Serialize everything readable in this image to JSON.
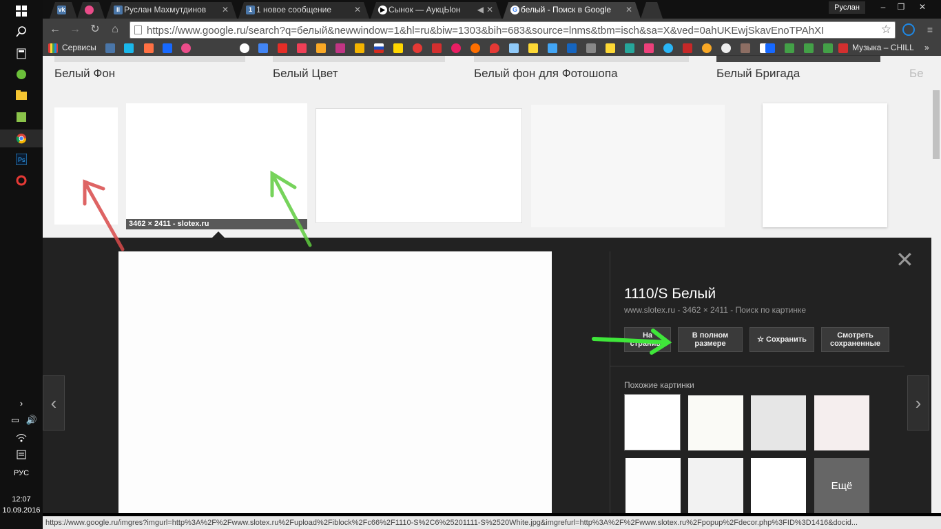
{
  "taskbar": {
    "lang": "РУС",
    "time": "12:07",
    "date": "10.09.2016"
  },
  "tabs": [
    {
      "label": "",
      "favicon": "vk-icon",
      "color": "#4a76a8"
    },
    {
      "label": "",
      "favicon": "dribbble-icon",
      "color": "#ea4c89"
    },
    {
      "label": "Руслан Махмутдинов",
      "favicon": "pause-icon",
      "color": "#4a76a8"
    },
    {
      "label": "1 новое сообщение",
      "favicon": "message-count-icon",
      "color": "#4a76a8"
    },
    {
      "label": "Сынок — АукцЫон",
      "favicon": "play-icon",
      "color": "#ffffff"
    },
    {
      "label": "белый - Поиск в Google",
      "favicon": "google-icon",
      "color": "#ffffff"
    }
  ],
  "window": {
    "user": "Руслан"
  },
  "toolbar": {
    "url": "https://www.google.ru/search?q=белый&newwindow=1&hl=ru&biw=1303&bih=683&source=lnms&tbm=isch&sa=X&ved=0ahUKEwjSkavEnoTPAhXI"
  },
  "bookmarks": {
    "apps_label": "Сервисы",
    "music_label": "Музыка – CHILL"
  },
  "related": [
    {
      "label": "Белый Фон"
    },
    {
      "label": "Белый Цвет"
    },
    {
      "label": "Белый фон для Фотошопа"
    },
    {
      "label": "Белый Бригада"
    },
    {
      "label": "Бе"
    }
  ],
  "grid": {
    "caption": "3462 × 2411 - slotex.ru"
  },
  "panel": {
    "title": "1110/S Белый",
    "subtitle": "www.slotex.ru - 3462 × 2411 - Поиск по картинке",
    "btn_page": "На странице",
    "btn_full": "В полном размере",
    "btn_save": "Сохранить",
    "btn_saved": "Смотреть сохраненные",
    "similar_label": "Похожие картинки",
    "more_label": "Ещё"
  },
  "status_url": "https://www.google.ru/imgres?imgurl=http%3A%2F%2Fwww.slotex.ru%2Fupload%2Fiblock%2Fc66%2F1110-S%2C6%25201111-S%2520White.jpg&imgrefurl=http%3A%2F%2Fwww.slotex.ru%2Fpopup%2Fdecor.php%3FID%3D1416&docid..."
}
